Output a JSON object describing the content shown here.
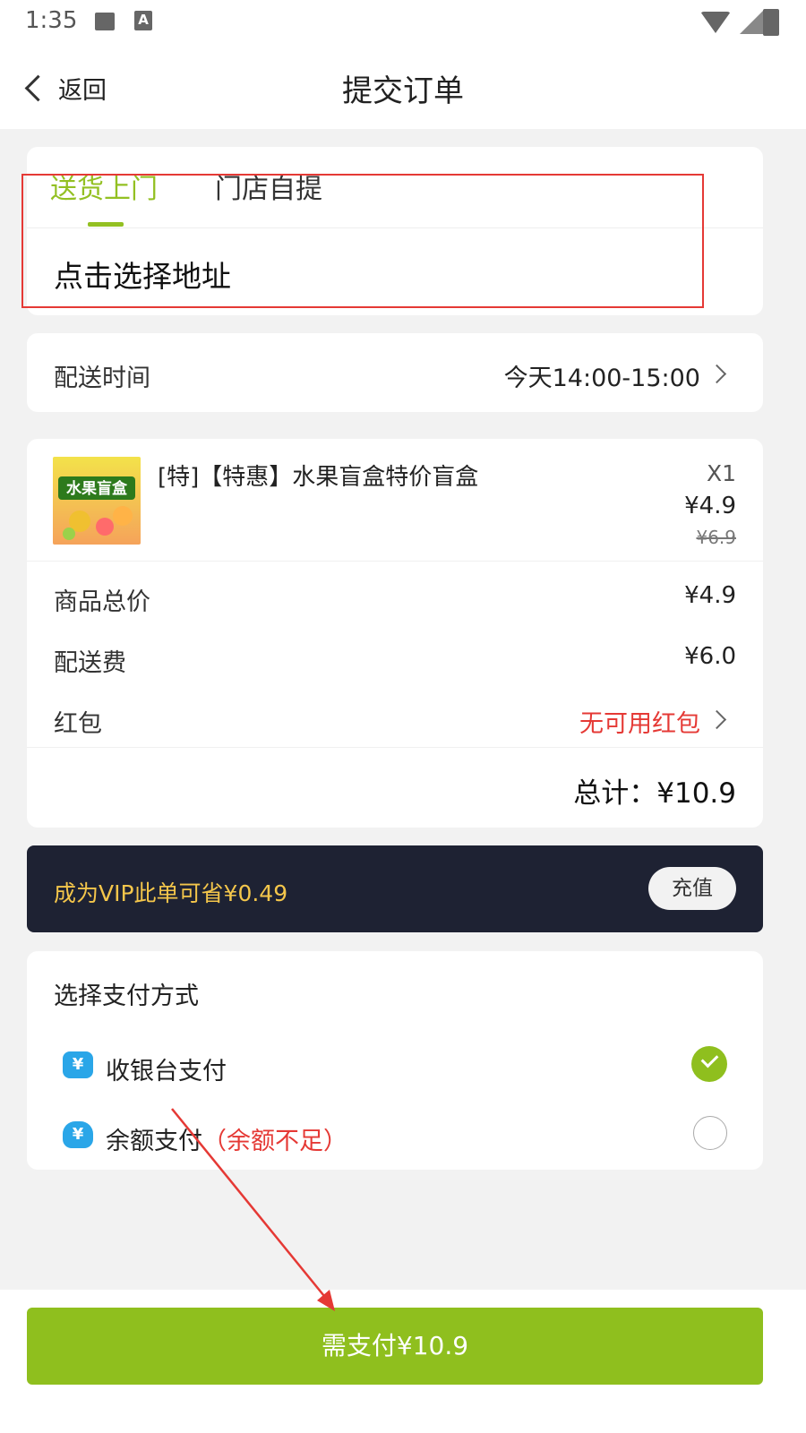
{
  "status_bar": {
    "time": "1:35",
    "a_glyph": "A"
  },
  "header": {
    "back_label": "返回",
    "title": "提交订单"
  },
  "delivery": {
    "tabs": [
      {
        "label": "送货上门",
        "active": true
      },
      {
        "label": "门店自提",
        "active": false
      }
    ],
    "address_prompt": "点击选择地址"
  },
  "delivery_time": {
    "label": "配送时间",
    "value": "今天14:00-15:00"
  },
  "product": {
    "name": "[特]【特惠】水果盲盒特价盲盒",
    "quantity": "X1",
    "price": "¥4.9",
    "original_price": "¥6.9",
    "thumb_text": "水果盲盒"
  },
  "summary": {
    "rows": [
      {
        "label": "商品总价",
        "value": "¥4.9"
      },
      {
        "label": "配送费",
        "value": "¥6.0"
      },
      {
        "label": "红包",
        "value": "无可用红包"
      }
    ],
    "total": "总计：¥10.9"
  },
  "vip": {
    "text": "成为VIP此单可省¥0.49",
    "button_label": "充值"
  },
  "payment": {
    "title": "选择支付方式",
    "methods": [
      {
        "label": "收银台支付",
        "note": "",
        "selected": true,
        "icon": "cashier-icon"
      },
      {
        "label": "余额支付",
        "note": "（余额不足）",
        "selected": false,
        "icon": "money-bag-icon"
      }
    ]
  },
  "pay_button": {
    "label": "需支付¥10.9"
  },
  "colors": {
    "accent": "#8fbf1e",
    "warning": "#e53935",
    "vip_bg": "#1e2233",
    "vip_text": "#f4c64b"
  }
}
